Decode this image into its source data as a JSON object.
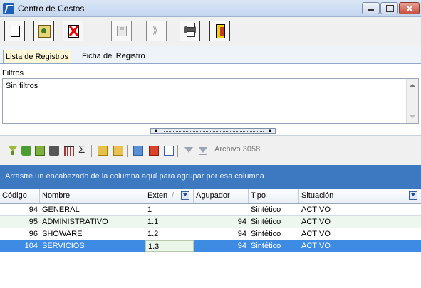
{
  "window": {
    "title": "Centro de Costos"
  },
  "tabs": [
    {
      "label": "Lista de Registros",
      "active": true
    },
    {
      "label": "Ficha del Registro",
      "active": false
    }
  ],
  "filters": {
    "label": "Filtros",
    "value": "Sin filtros"
  },
  "grid_toolbar": {
    "archive_label": "Archivo 3058"
  },
  "group_hint": "Arrastre un encabezado de la columna aquí para agrupar por esa columna",
  "columns": [
    "Código",
    "Nombre",
    "Exten",
    "Agupador",
    "Tipo",
    "Situación"
  ],
  "rows": [
    {
      "codigo": "94",
      "nombre": "GENERAL",
      "exten": "1",
      "agupador": "",
      "tipo": "Sintético",
      "situacion": "ACTIVO"
    },
    {
      "codigo": "95",
      "nombre": "ADMINISTRATIVO",
      "exten": "1.1",
      "agupador": "94",
      "tipo": "Sintético",
      "situacion": "ACTIVO"
    },
    {
      "codigo": "96",
      "nombre": "SHOWARE",
      "exten": "1.2",
      "agupador": "94",
      "tipo": "Sintético",
      "situacion": "ACTIVO"
    },
    {
      "codigo": "104",
      "nombre": "SERVICIOS",
      "exten": "1.3",
      "agupador": "94",
      "tipo": "Sintético",
      "situacion": "ACTIVO"
    }
  ],
  "colors": {
    "group_bar": "#3d79c0",
    "selected_row": "#3d8be3",
    "alt_row": "#edf7ed"
  },
  "icons": {
    "toolbar": [
      "new-document-icon",
      "edit-icon",
      "delete-icon",
      "save-icon",
      "undo-icon",
      "print-icon",
      "exit-icon"
    ],
    "grid": [
      "filter-icon",
      "refresh-icon",
      "export-icon",
      "print-icon",
      "columns-icon",
      "sigma-icon",
      "open-icon",
      "folder-icon",
      "copy-icon",
      "stop-icon",
      "check-icon",
      "collapse-icon",
      "expand-icon"
    ]
  }
}
